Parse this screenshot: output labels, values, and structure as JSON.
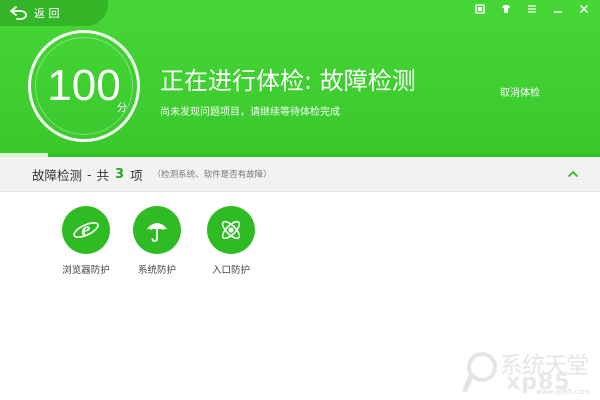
{
  "nav": {
    "back_label": "返 回"
  },
  "window_controls": [
    {
      "icon": "skin-icon"
    },
    {
      "icon": "shirt-icon"
    },
    {
      "icon": "menu-icon"
    },
    {
      "icon": "minimize-icon"
    },
    {
      "icon": "close-icon"
    }
  ],
  "header": {
    "score": "100",
    "score_unit": "分",
    "title": "正在进行体检: 故障检测",
    "subtitle": "尚未发现问题项目，请继续等待体检完成",
    "cancel_label": "取消体检",
    "progress_fraction": 0.08
  },
  "section": {
    "title": "故障检测",
    "dash": "-",
    "total_prefix": "共",
    "count": "3",
    "total_suffix": "项",
    "note": "（检测系统、软件是否有故障）"
  },
  "items": [
    {
      "label": "浏览器防护",
      "icon": "ie-browser-icon"
    },
    {
      "label": "系统防护",
      "icon": "umbrella-icon"
    },
    {
      "label": "入口防护",
      "icon": "atom-icon"
    }
  ],
  "watermark": {
    "zh": "系统天堂",
    "en": "xp85",
    "url": "www.xp85.com"
  },
  "colors": {
    "header_green": "#3fcf31",
    "accent_green": "#2fbb24",
    "count_green": "#27a51c"
  }
}
